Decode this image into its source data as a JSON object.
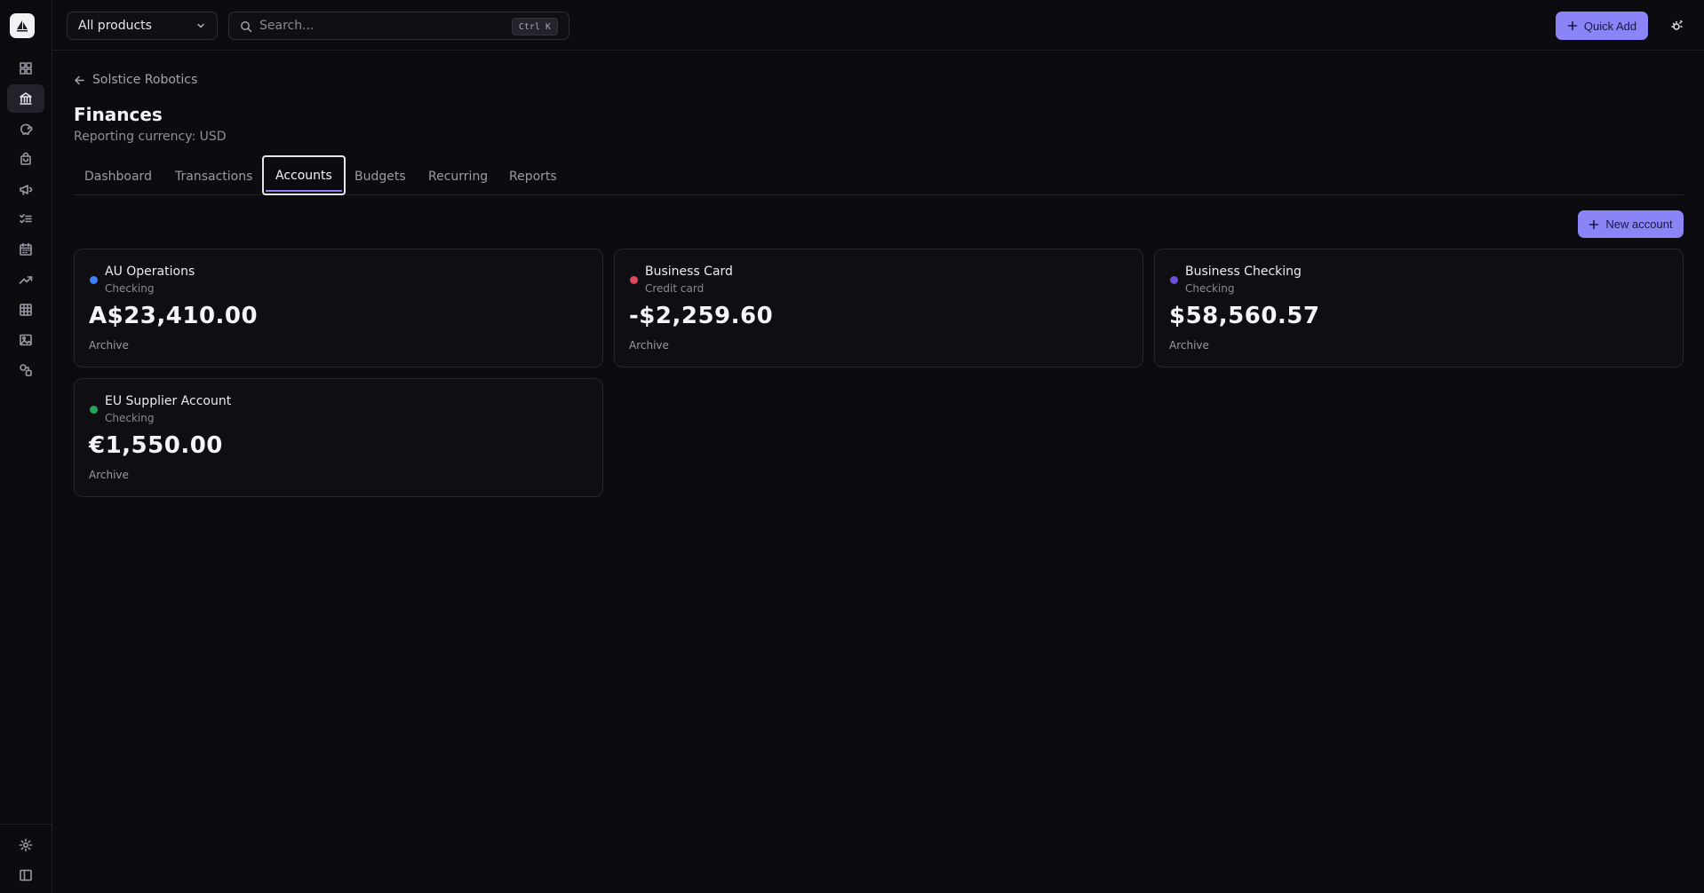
{
  "topbar": {
    "product_select": "All products",
    "search_placeholder": "Search...",
    "search_shortcut": "Ctrl K",
    "quick_add_label": "Quick Add"
  },
  "breadcrumb": {
    "back_label": "Solstice Robotics"
  },
  "page": {
    "title": "Finances",
    "subtitle": "Reporting currency: USD"
  },
  "tabs": [
    {
      "label": "Dashboard"
    },
    {
      "label": "Transactions"
    },
    {
      "label": "Accounts",
      "active": true
    },
    {
      "label": "Budgets"
    },
    {
      "label": "Recurring"
    },
    {
      "label": "Reports"
    }
  ],
  "new_account_label": "New account",
  "accounts": [
    {
      "name": "AU Operations",
      "type": "Checking",
      "balance": "A$23,410.00",
      "action": "Archive",
      "color": "#3b82f6"
    },
    {
      "name": "Business Card",
      "type": "Credit card",
      "balance": "-$2,259.60",
      "action": "Archive",
      "color": "#e0465e"
    },
    {
      "name": "Business Checking",
      "type": "Checking",
      "balance": "$58,560.57",
      "action": "Archive",
      "color": "#6d4fd6"
    },
    {
      "name": "EU Supplier Account",
      "type": "Checking",
      "balance": "€1,550.00",
      "action": "Archive",
      "color": "#22a55b"
    }
  ],
  "sidebar": {
    "items": [
      {
        "icon": "dashboard-grid-icon"
      },
      {
        "icon": "finances-icon",
        "active": true
      },
      {
        "icon": "piggy-bank-icon"
      },
      {
        "icon": "shopping-bag-icon"
      },
      {
        "icon": "megaphone-icon"
      },
      {
        "icon": "checklist-icon"
      },
      {
        "icon": "calendar-icon"
      },
      {
        "icon": "trending-up-icon"
      },
      {
        "icon": "table-icon"
      },
      {
        "icon": "image-icon"
      },
      {
        "icon": "shapes-icon"
      }
    ],
    "bottom_items": [
      {
        "icon": "gear-icon"
      },
      {
        "icon": "sidebar-panel-icon"
      }
    ]
  },
  "colors": {
    "accent": "#8b84f7",
    "background": "#0c0c10"
  }
}
